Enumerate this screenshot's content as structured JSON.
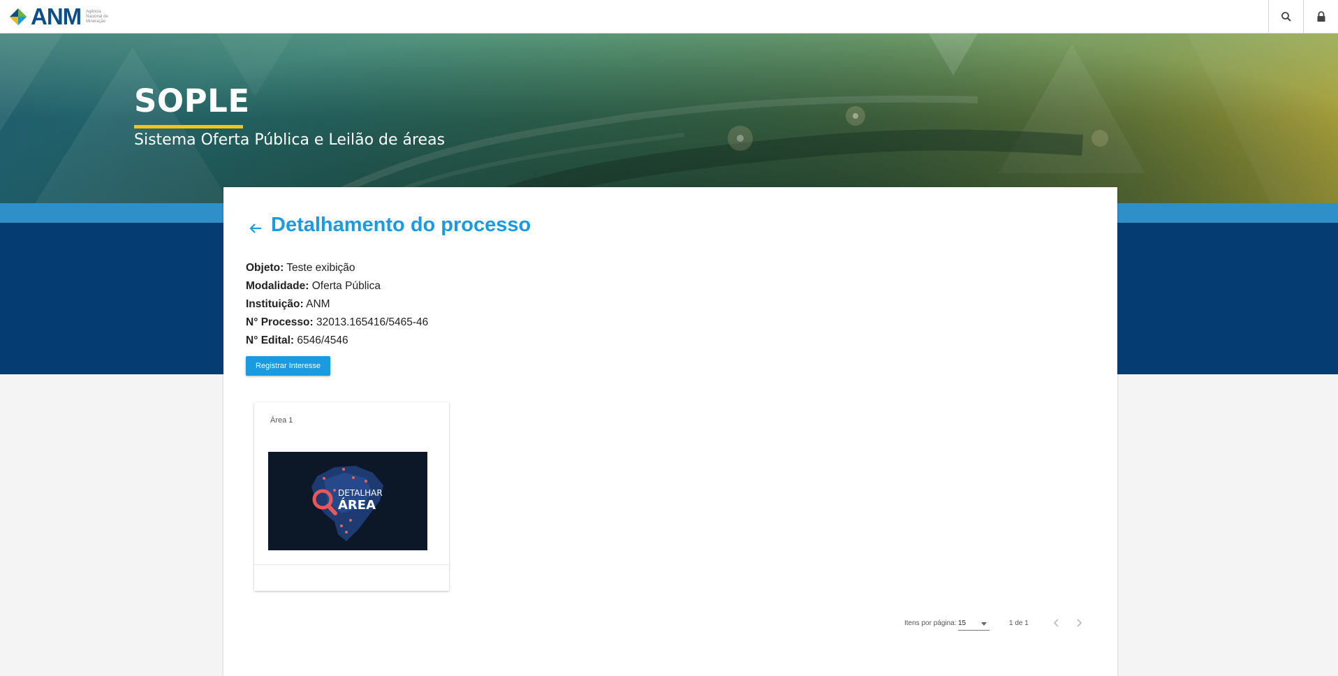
{
  "header": {
    "logo_text": "ANM",
    "logo_subtitle": "Agência Nacional de Mineração",
    "search_icon": "search-icon",
    "lock_icon": "lock-icon"
  },
  "banner": {
    "title": "SOPLE",
    "subtitle": "Sistema Oferta Pública e Leilão de áreas"
  },
  "page": {
    "title": "Detalhamento do processo",
    "back_icon": "arrow-left-icon",
    "fields": [
      {
        "label": "Objeto:",
        "value": "Teste exibição"
      },
      {
        "label": "Modalidade:",
        "value": "Oferta Pública"
      },
      {
        "label": "Instituição:",
        "value": "ANM"
      },
      {
        "label": "N° Processo:",
        "value": "32013.165416/5465-46"
      },
      {
        "label": "N° Edital:",
        "value": "6546/4546"
      }
    ],
    "register_button": "Registrar Interesse"
  },
  "areas": [
    {
      "title": "Área 1",
      "image_text_top": "DETALHAR",
      "image_text_bottom": "ÁREA"
    }
  ],
  "paginator": {
    "items_per_page_label": "Itens por página:",
    "items_per_page_value": "15",
    "range_label": "1 de 1"
  },
  "colors": {
    "accent": "#1a9ae0",
    "dark_band": "#053c72",
    "light_band": "#2e8fc9",
    "banner_underline": "#f0c419",
    "logo_blue": "#0b4e8a"
  }
}
